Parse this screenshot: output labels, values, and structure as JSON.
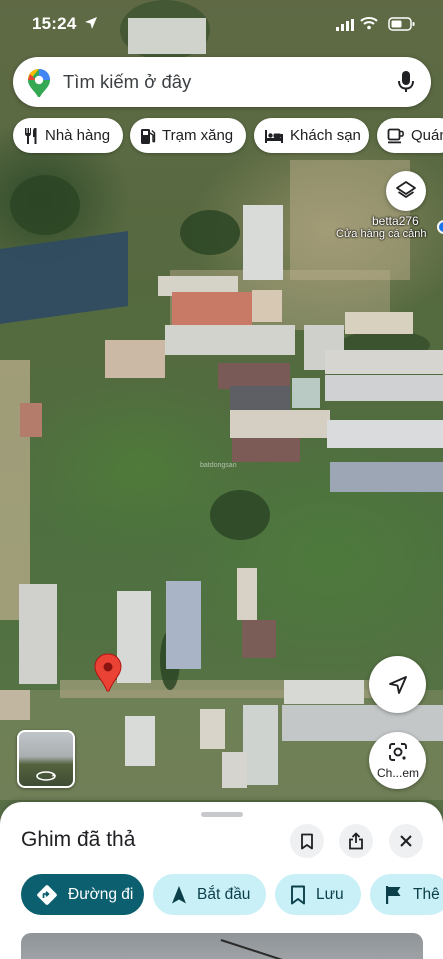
{
  "status_bar": {
    "time": "15:24"
  },
  "search": {
    "placeholder": "Tìm kiếm ở đây"
  },
  "chips": [
    {
      "label": "Nhà hàng",
      "icon": "fork-knife-icon"
    },
    {
      "label": "Trạm xăng",
      "icon": "gas-station-icon"
    },
    {
      "label": "Khách sạn",
      "icon": "bed-icon"
    },
    {
      "label": "Quán",
      "icon": "coffee-cup-icon"
    }
  ],
  "map": {
    "poi": {
      "name": "betta276",
      "category": "Cửa hàng cá cảnh"
    },
    "watermark": "batdongsan"
  },
  "controls": {
    "lens_label": "Ch...em"
  },
  "sheet": {
    "title": "Ghim đã thả",
    "actions": [
      {
        "label": "Đường đi",
        "icon": "directions-icon"
      },
      {
        "label": "Bắt đầu",
        "icon": "navigation-arrow-icon"
      },
      {
        "label": "Lưu",
        "icon": "bookmark-icon"
      },
      {
        "label": "Thê",
        "icon": "flag-icon"
      }
    ]
  },
  "colors": {
    "primary": "#0b5f6e",
    "secondary": "#c9eff7",
    "pin": "#ea4335"
  }
}
